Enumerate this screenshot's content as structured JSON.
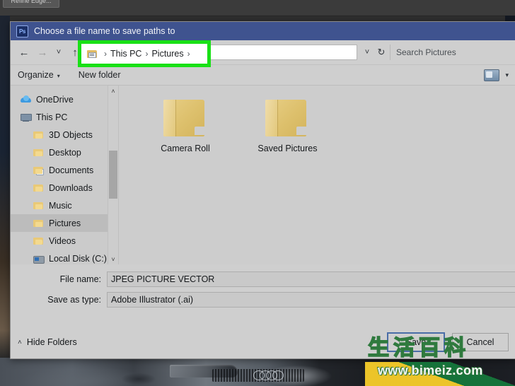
{
  "backdrop": {
    "app_button_label": "Refine Edge..."
  },
  "dialog": {
    "title": "Choose a file name to save paths to",
    "app_icon": "photoshop-ps-icon",
    "nav": {
      "back_icon": "arrow-left-icon",
      "forward_icon": "arrow-right-icon",
      "recent_icon": "chevron-down-icon",
      "up_icon": "arrow-up-icon",
      "refresh_icon": "refresh-icon",
      "breadcrumb": {
        "folder_icon": "pictures-folder-icon",
        "separator": "›",
        "items": [
          "This PC",
          "Pictures"
        ],
        "trailing_separator": "›"
      },
      "search": {
        "placeholder": "Search Pictures",
        "icon": "search-icon"
      }
    },
    "toolbar": {
      "organize_label": "Organize",
      "organize_caret": "▾",
      "new_folder_label": "New folder",
      "view_icon": "view-layout-icon",
      "view_caret": "▾"
    },
    "sidebar": {
      "scroll_up_icon": "˄",
      "scroll_down_icon": "˅",
      "items": [
        {
          "label": "OneDrive",
          "icon": "onedrive-cloud-icon",
          "indent": false,
          "selected": false
        },
        {
          "label": "This PC",
          "icon": "this-pc-icon",
          "indent": false,
          "selected": false
        },
        {
          "label": "3D Objects",
          "icon": "3d-objects-folder-icon",
          "indent": true,
          "selected": false
        },
        {
          "label": "Desktop",
          "icon": "desktop-folder-icon",
          "indent": true,
          "selected": false
        },
        {
          "label": "Documents",
          "icon": "documents-folder-icon",
          "indent": true,
          "selected": false
        },
        {
          "label": "Downloads",
          "icon": "downloads-folder-icon",
          "indent": true,
          "selected": false
        },
        {
          "label": "Music",
          "icon": "music-folder-icon",
          "indent": true,
          "selected": false
        },
        {
          "label": "Pictures",
          "icon": "pictures-folder-icon",
          "indent": true,
          "selected": true
        },
        {
          "label": "Videos",
          "icon": "videos-folder-icon",
          "indent": true,
          "selected": false
        },
        {
          "label": "Local Disk (C:)",
          "icon": "local-disk-icon",
          "indent": true,
          "selected": false
        }
      ]
    },
    "files": [
      {
        "name": "Camera Roll",
        "icon": "folder-icon"
      },
      {
        "name": "Saved Pictures",
        "icon": "folder-icon"
      }
    ],
    "fields": {
      "file_name_label": "File name:",
      "file_name_value": "JPEG PICTURE VECTOR",
      "save_as_type_label": "Save as type:",
      "save_as_type_value": "Adobe Illustrator (.ai)"
    },
    "footer": {
      "hide_folders_label": "Hide Folders",
      "hide_folders_caret": "˄",
      "save_label": "Save",
      "cancel_label": "Cancel"
    }
  },
  "annotation": {
    "highlight_color": "#19e016",
    "target": "address-bar-breadcrumb"
  },
  "watermark": {
    "cjk_text": "生活百科",
    "url": "www.bimeiz.com",
    "stroke_color": "#2f7a3e",
    "banner_colors": [
      "#157a3c",
      "#f7c928"
    ]
  }
}
